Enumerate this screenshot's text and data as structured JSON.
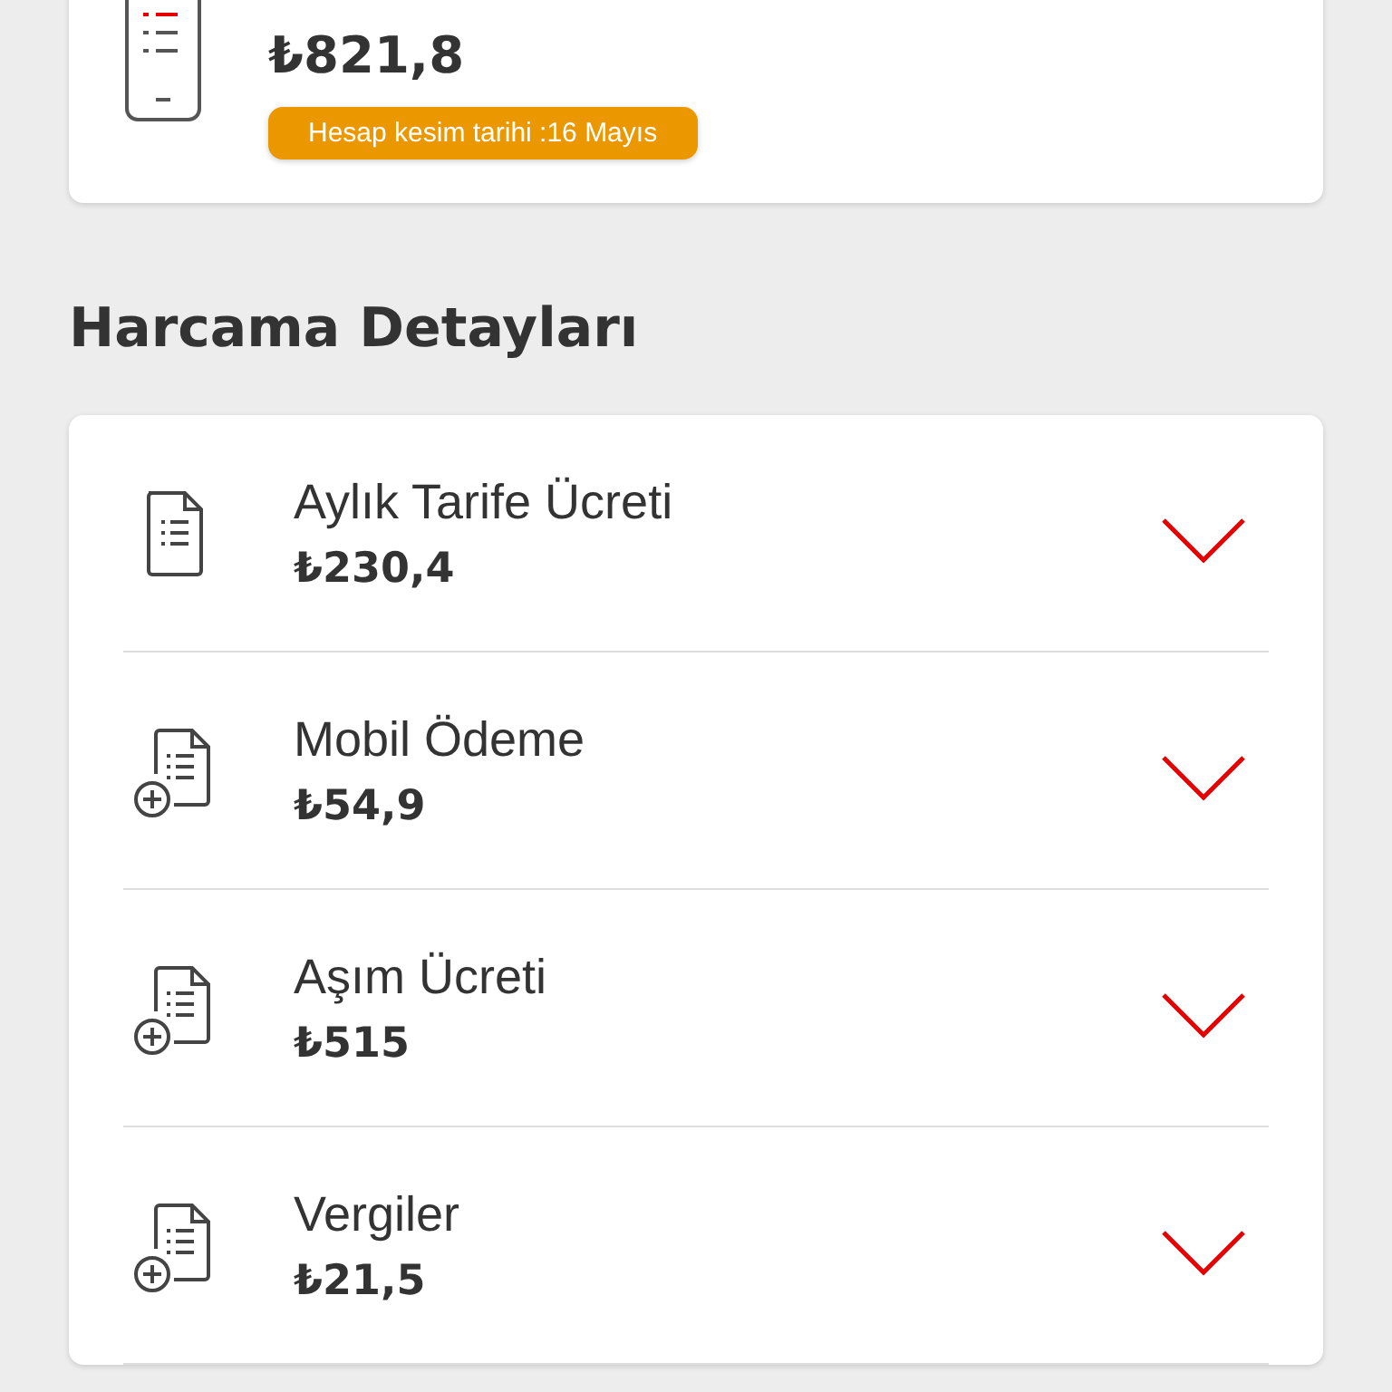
{
  "summary": {
    "amount": "₺821,8",
    "cutoff_badge": "Hesap kesim tarihi :16 Mayıs"
  },
  "section_title": "Harcama Detayları",
  "items": [
    {
      "kind": "document",
      "title": "Aylık Tarife Ücreti",
      "amount": "₺230,4"
    },
    {
      "kind": "document-add",
      "title": "Mobil Ödeme",
      "amount": "₺54,9"
    },
    {
      "kind": "document-add",
      "title": "Aşım Ücreti",
      "amount": "₺515"
    },
    {
      "kind": "document-add",
      "title": "Vergiler",
      "amount": "₺21,5"
    }
  ]
}
